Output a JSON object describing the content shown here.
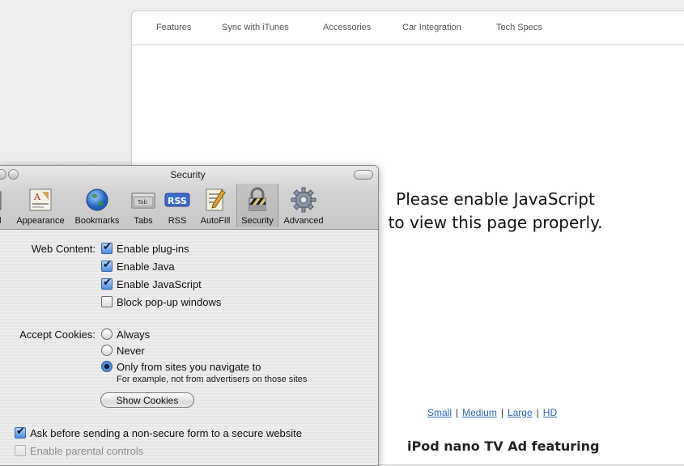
{
  "page": {
    "nav": [
      "Features",
      "Sync with iTunes",
      "Accessories",
      "Car Integration",
      "Tech Specs"
    ],
    "js_notice": [
      "Please enable JavaScript",
      "to view this page properly."
    ],
    "size_links": [
      "Small",
      "Medium",
      "Large",
      "HD"
    ],
    "separator": "|",
    "ad_title": "iPod nano TV Ad featuring"
  },
  "window": {
    "title": "Security",
    "toolbar": [
      {
        "label": "al",
        "icon": "general-icon"
      },
      {
        "label": "Appearance",
        "icon": "appearance-icon"
      },
      {
        "label": "Bookmarks",
        "icon": "globe-icon"
      },
      {
        "label": "Tabs",
        "icon": "tabs-icon",
        "icon_text": "Tab"
      },
      {
        "label": "RSS",
        "icon": "rss-icon",
        "icon_text": "RSS"
      },
      {
        "label": "AutoFill",
        "icon": "autofill-icon"
      },
      {
        "label": "Security",
        "icon": "lock-icon",
        "selected": true
      },
      {
        "label": "Advanced",
        "icon": "gear-icon"
      }
    ],
    "web_content": {
      "label": "Web Content:",
      "options": [
        {
          "label": "Enable plug-ins",
          "checked": true
        },
        {
          "label": "Enable Java",
          "checked": true
        },
        {
          "label": "Enable JavaScript",
          "checked": true
        },
        {
          "label": "Block pop-up windows",
          "checked": false
        }
      ]
    },
    "cookies": {
      "label": "Accept Cookies:",
      "options": [
        {
          "label": "Always",
          "selected": false
        },
        {
          "label": "Never",
          "selected": false
        },
        {
          "label": "Only from sites you navigate to",
          "selected": true
        }
      ],
      "note": "For example, not from advertisers on those sites",
      "show_button": "Show Cookies"
    },
    "ask_before": {
      "label": "Ask before sending a non-secure form to a secure website",
      "checked": true
    },
    "parental": {
      "label": "Enable parental controls",
      "checked": false,
      "enabled": false
    }
  },
  "colors": {
    "link": "#2a66b8",
    "accent": "#4d8ede"
  }
}
